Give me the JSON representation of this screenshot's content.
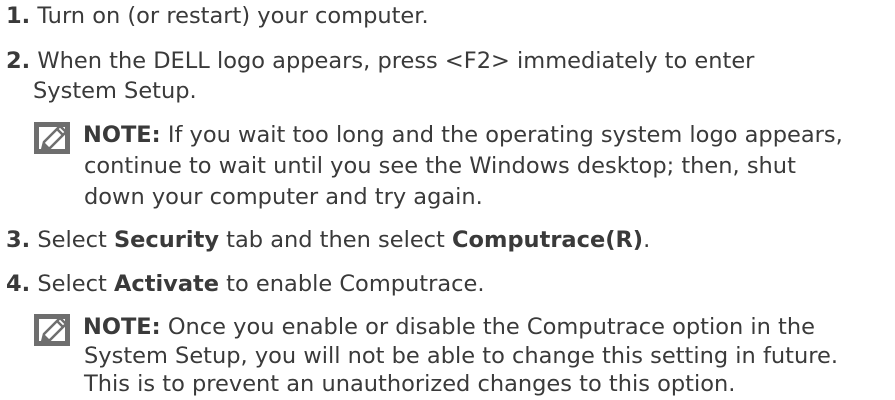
{
  "steps": [
    {
      "num": "1.",
      "text": "Turn on (or restart) your computer."
    },
    {
      "num": "2.",
      "text_line1": "When the DELL logo appears, press <F2> immediately to enter",
      "text_line2": "System Setup."
    },
    {
      "num": "3.",
      "pre": "Select ",
      "b1": "Security",
      "mid": " tab and then select ",
      "b2": "Computrace(R)",
      "post": "."
    },
    {
      "num": "4.",
      "pre": "Select ",
      "b1": "Activate",
      "post": " to enable Computrace."
    }
  ],
  "note1": {
    "label": "NOTE:",
    "line1": " If you wait too long and the operating system logo appears,",
    "line2": "continue to wait until you see the Windows desktop; then, shut",
    "line3": "down your computer and try again."
  },
  "note2": {
    "label": "NOTE:",
    "line1": " Once you enable or disable the Computrace option in the",
    "line2": "System Setup, you will not be able to change this setting in future.",
    "line3": "This is to prevent an unauthorized changes to this option."
  },
  "icons": {
    "note": "pencil-note-icon"
  }
}
